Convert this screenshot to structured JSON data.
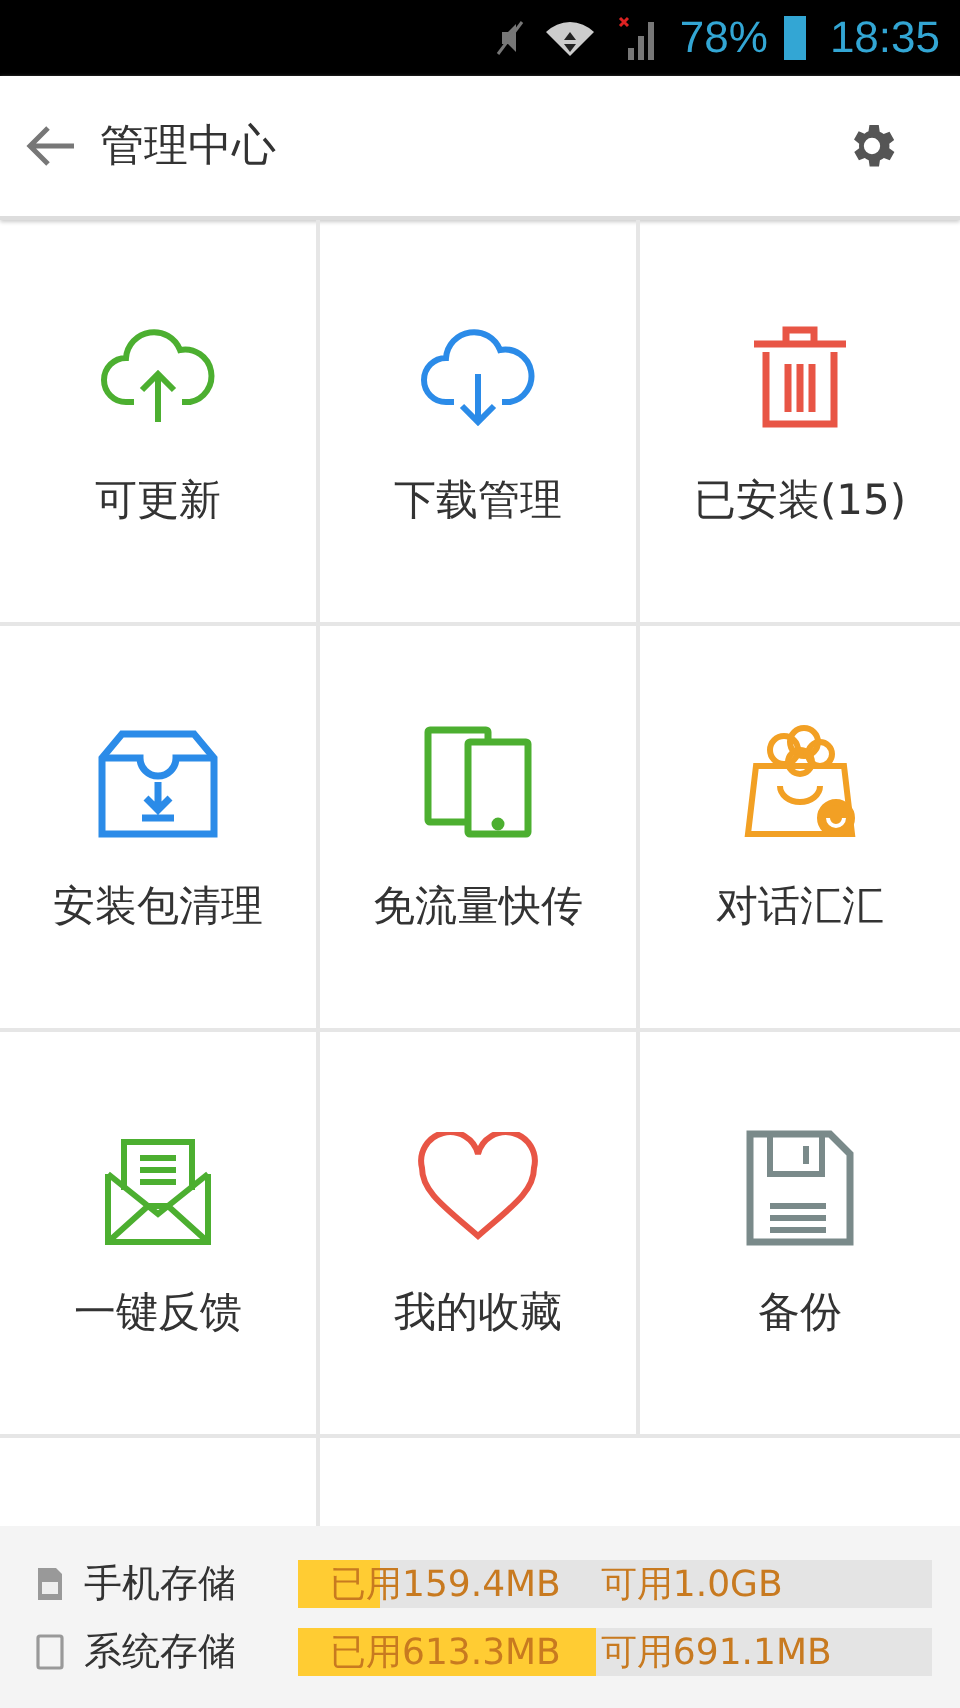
{
  "status_bar": {
    "battery": "78%",
    "time": "18:35"
  },
  "header": {
    "title": "管理中心"
  },
  "tiles": [
    {
      "kind": "upload",
      "label": "可更新"
    },
    {
      "kind": "download",
      "label": "下载管理"
    },
    {
      "kind": "trash",
      "label": "已安装(15)"
    },
    {
      "kind": "package",
      "label": "安装包清理"
    },
    {
      "kind": "phones",
      "label": "免流量快传"
    },
    {
      "kind": "bag",
      "label": "对话汇汇"
    },
    {
      "kind": "mail",
      "label": "一键反馈"
    },
    {
      "kind": "heart",
      "label": "我的收藏"
    },
    {
      "kind": "floppy",
      "label": "备份"
    }
  ],
  "storage": [
    {
      "kind": "phone",
      "name": "手机存储",
      "used": "已用159.4MB",
      "free": "可用1.0GB",
      "level": 0.13
    },
    {
      "kind": "system",
      "name": "系统存储",
      "used": "已用613.3MB",
      "free": "可用691.1MB",
      "level": 0.47
    }
  ]
}
